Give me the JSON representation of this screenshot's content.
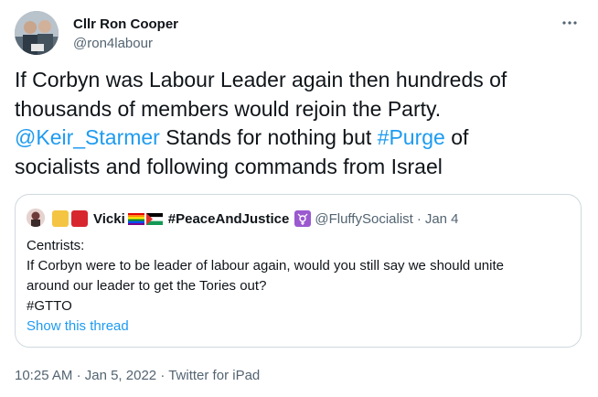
{
  "author": {
    "name": "Cllr Ron Cooper",
    "handle": "@ron4labour"
  },
  "tweet": {
    "line1": "If Corbyn was Labour Leader again then hundreds of",
    "line2": "thousands of members would rejoin the Party.",
    "mention": "@Keir_Starmer",
    "line3_mid": " Stands for nothing but ",
    "hashtag": "#Purge",
    "line3_end": " of",
    "line4": "socialists and following commands from Israel"
  },
  "quote": {
    "name": "Vicki",
    "tag": "#PeaceAndJustice",
    "handle": "@FluffySocialist",
    "sep": "·",
    "date": "Jan 4",
    "body": [
      "Centrists:",
      "If Corbyn were to be leader of labour again, would you still say we should unite",
      "around our leader to get the Tories out?",
      "#GTTO"
    ],
    "show_thread": "Show this thread",
    "square_colors": [
      "#f4c542",
      "#d8262f"
    ]
  },
  "meta": {
    "time": "10:25 AM",
    "date": "Jan 5, 2022",
    "source": "Twitter for iPad",
    "sep": "·"
  },
  "colors": {
    "link": "#1d9bf0",
    "secondary": "#536471",
    "border": "#cfd9de"
  },
  "icons": {
    "more": "more-dots-icon",
    "rainbow_flag": "rainbow-flag-icon",
    "palestine_flag": "palestine-flag-icon",
    "transgender_symbol": "transgender-symbol-icon"
  }
}
